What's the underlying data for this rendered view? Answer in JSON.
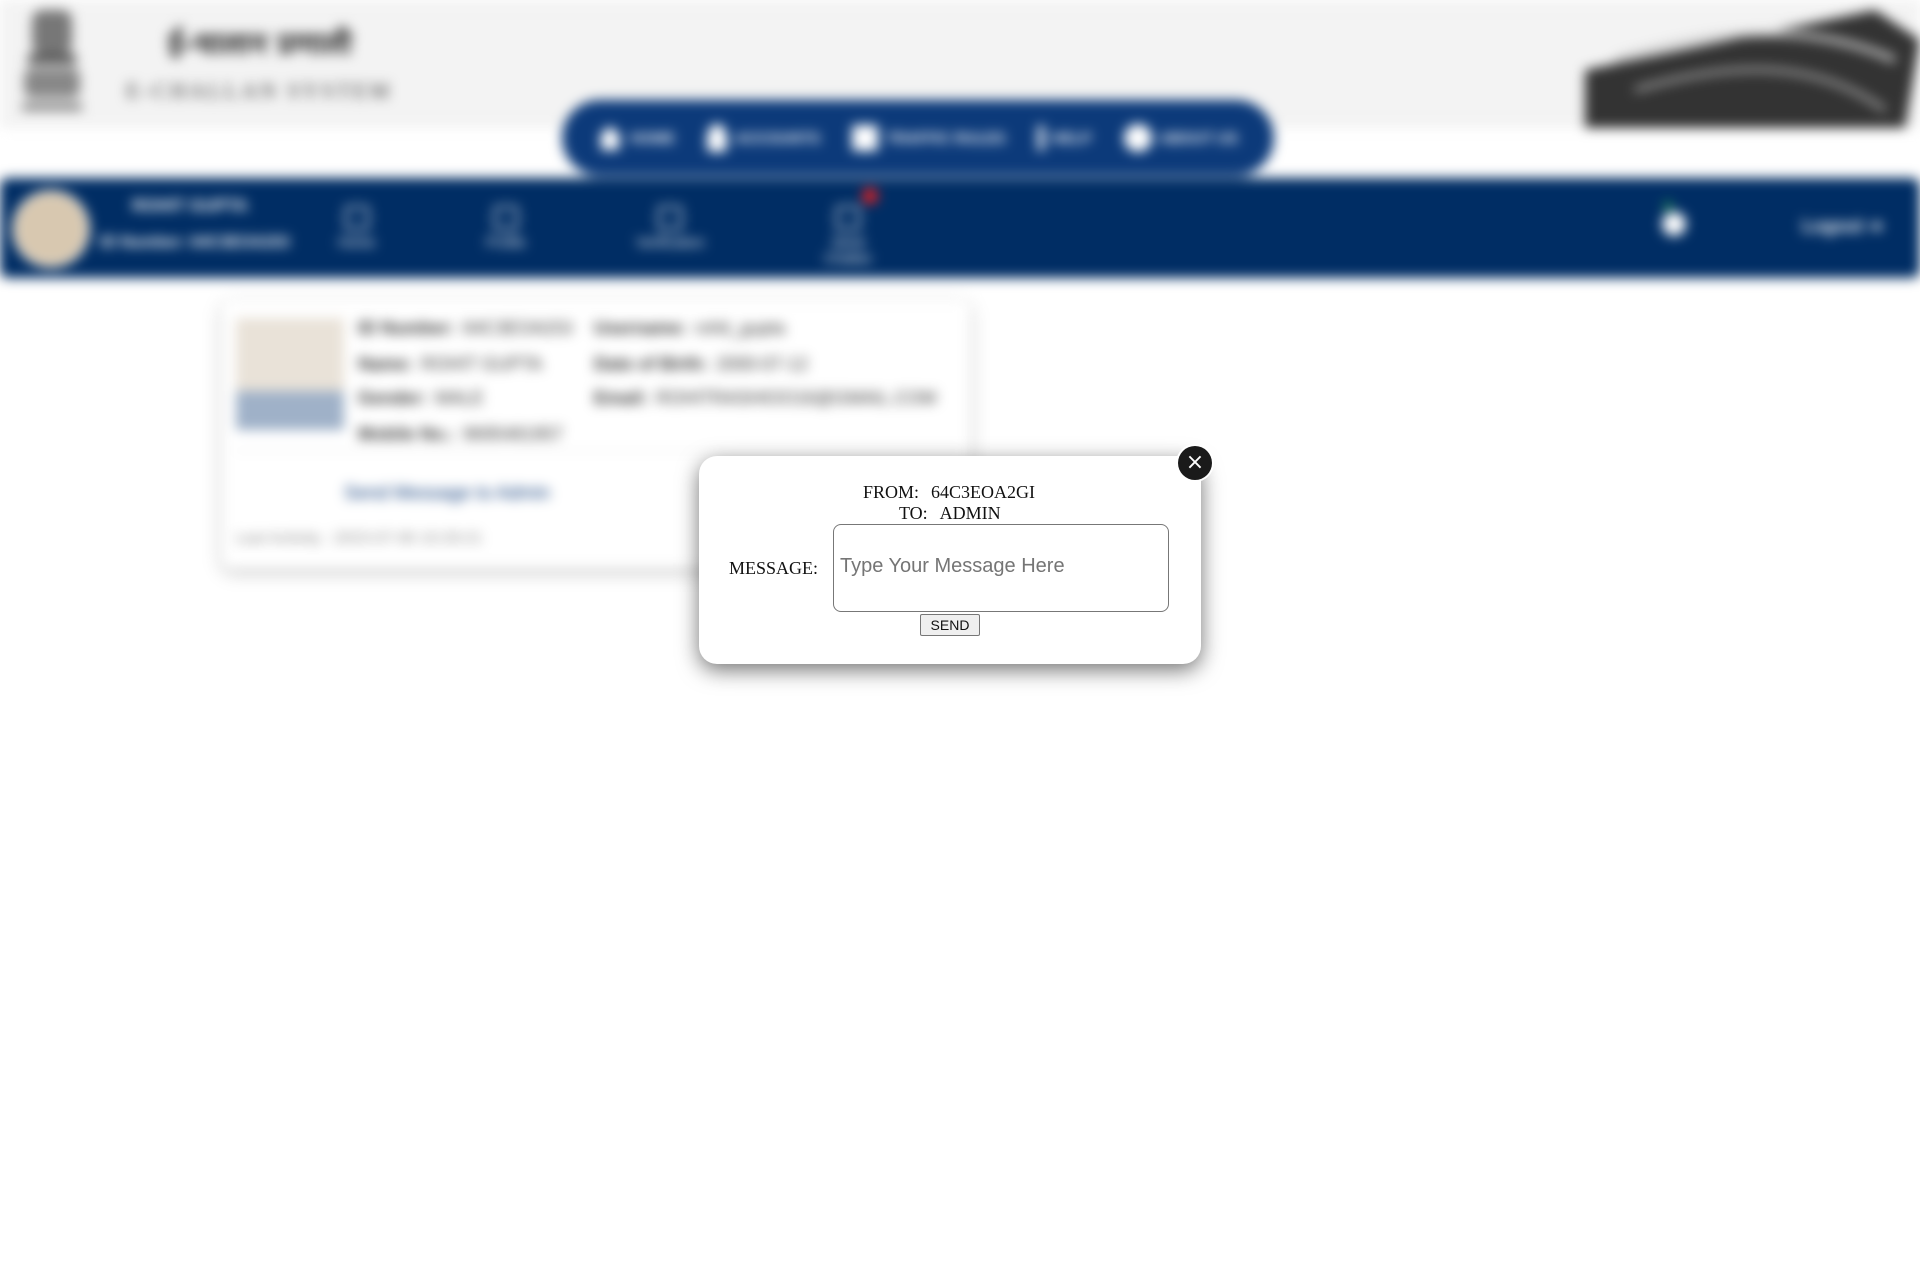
{
  "header": {
    "title_hindi": "ई-चालान प्रणाली",
    "title_english": "E-CHALLAN SYSTEM"
  },
  "topnav": {
    "items": [
      {
        "label": "HOME",
        "icon": "home-icon"
      },
      {
        "label": "ACCOUNTS",
        "icon": "person-icon"
      },
      {
        "label": "TRAFFIC RULES",
        "icon": "sign-icon"
      },
      {
        "label": "HELP",
        "icon": "help-icon"
      },
      {
        "label": "ABOUT US",
        "icon": "info-icon"
      }
    ]
  },
  "userbar": {
    "name": "ROHIT GUPTA",
    "id_line": "ID Number: 64C3EOA2GI",
    "items": [
      {
        "label": "Home",
        "icon": "home-icon"
      },
      {
        "label": "Profile",
        "icon": "profile-icon"
      },
      {
        "label": "Verification",
        "icon": "verify-icon"
      },
      {
        "label": "Send Challan",
        "icon": "challan-icon"
      }
    ],
    "logout_label": "Logout ➜"
  },
  "profile": {
    "id_number": {
      "label": "ID Number:",
      "value": "64C3EOA2GI"
    },
    "username": {
      "label": "Username:",
      "value": "rohit_gupta"
    },
    "name": {
      "label": "Name:",
      "value": "ROHIT GUPTA"
    },
    "dob": {
      "label": "Date of Birth:",
      "value": "2000-07-12"
    },
    "gender": {
      "label": "Gender:",
      "value": "MALE"
    },
    "email": {
      "label": "Email:",
      "value": "ROHITRASHIOO16@GMAIL.COM"
    },
    "mobile": {
      "label": "Mobile No.:",
      "value": "9695481957"
    },
    "send_message_label": "Send Message to Admin",
    "last_activity": "Last Activity : 2023-07-06 10:29:21"
  },
  "modal": {
    "from_label": "FROM:",
    "from_value": "64C3EOA2GI",
    "to_label": "TO:",
    "to_value": "ADMIN",
    "message_label": "MESSAGE:",
    "message_placeholder": "Type Your Message Here",
    "message_value": "",
    "send_label": "SEND",
    "close_label": "×"
  }
}
